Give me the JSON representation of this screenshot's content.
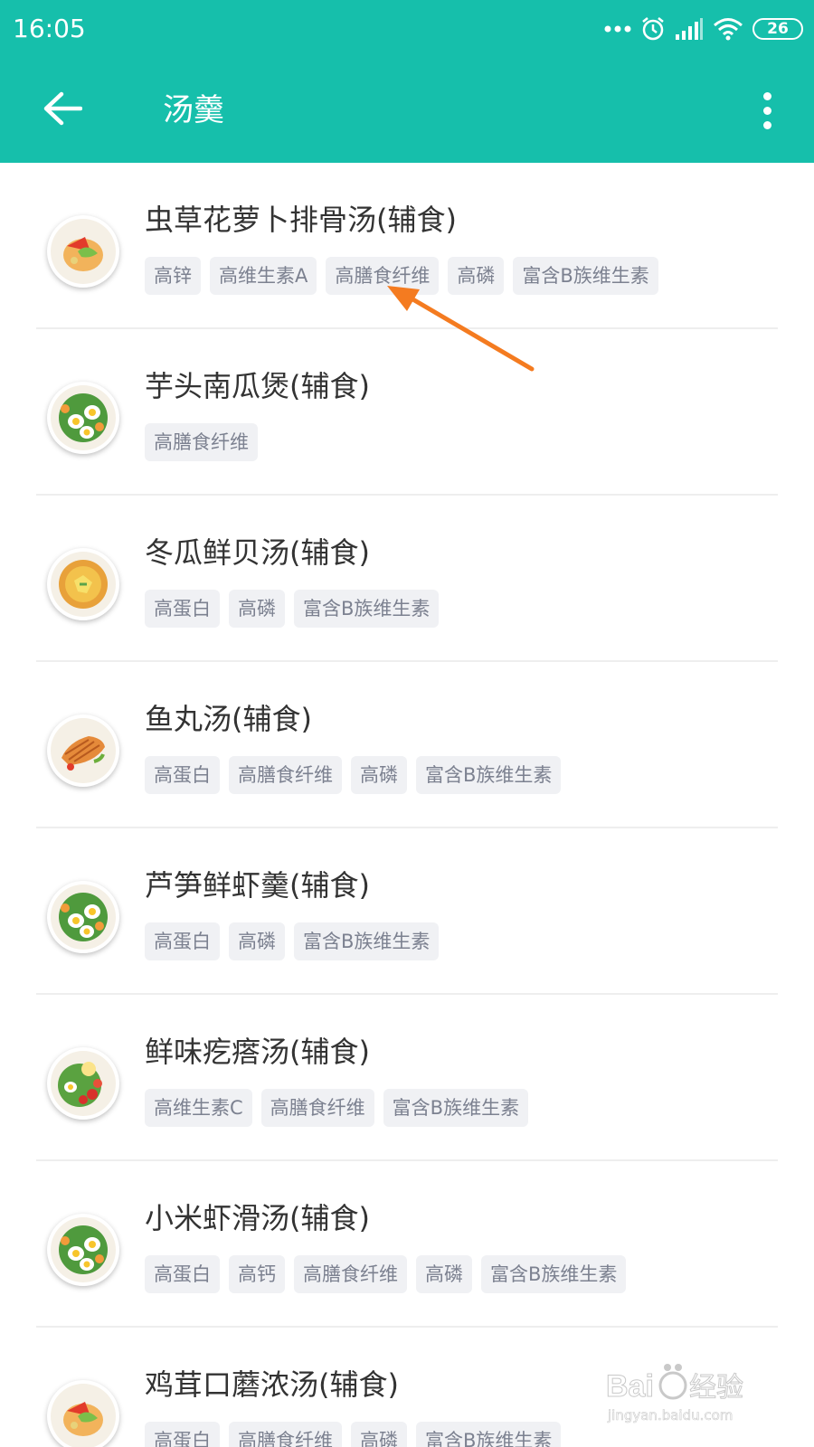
{
  "status_bar": {
    "time": "16:05",
    "battery": "26",
    "icons": [
      "more-dots-icon",
      "alarm-icon",
      "signal-icon",
      "wifi-icon",
      "battery-icon"
    ]
  },
  "app_bar": {
    "title": "汤羹",
    "back_icon": "back-arrow-icon",
    "menu_icon": "more-vertical-icon",
    "color": "#16bfab"
  },
  "recipes": [
    {
      "name": "虫草花萝卜排骨汤(辅食)",
      "image": "salmon-dish",
      "tags": [
        "高锌",
        "高维生素A",
        "高膳食纤维",
        "高磷",
        "富含B族维生素"
      ]
    },
    {
      "name": "芋头南瓜煲(辅食)",
      "image": "egg-salad",
      "tags": [
        "高膳食纤维"
      ]
    },
    {
      "name": "冬瓜鲜贝汤(辅食)",
      "image": "soup-bowl",
      "tags": [
        "高蛋白",
        "高磷",
        "富含B族维生素"
      ]
    },
    {
      "name": "鱼丸汤(辅食)",
      "image": "grilled-fish",
      "tags": [
        "高蛋白",
        "高膳食纤维",
        "高磷",
        "富含B族维生素"
      ]
    },
    {
      "name": "芦笋鲜虾羹(辅食)",
      "image": "egg-salad",
      "tags": [
        "高蛋白",
        "高磷",
        "富含B族维生素"
      ]
    },
    {
      "name": "鲜味疙瘩汤(辅食)",
      "image": "veggie-salad",
      "tags": [
        "高维生素C",
        "高膳食纤维",
        "富含B族维生素"
      ]
    },
    {
      "name": "小米虾滑汤(辅食)",
      "image": "egg-salad",
      "tags": [
        "高蛋白",
        "高钙",
        "高膳食纤维",
        "高磷",
        "富含B族维生素"
      ]
    },
    {
      "name": "鸡茸口蘑浓汤(辅食)",
      "image": "salmon-dish",
      "tags": [
        "高蛋白",
        "高膳食纤维",
        "高磷",
        "富含B族维生素"
      ]
    }
  ],
  "annotation": {
    "arrow_color": "#f47b20"
  },
  "watermark": {
    "text": "Baidu经验",
    "sub": "jingyan.baidu.com"
  }
}
